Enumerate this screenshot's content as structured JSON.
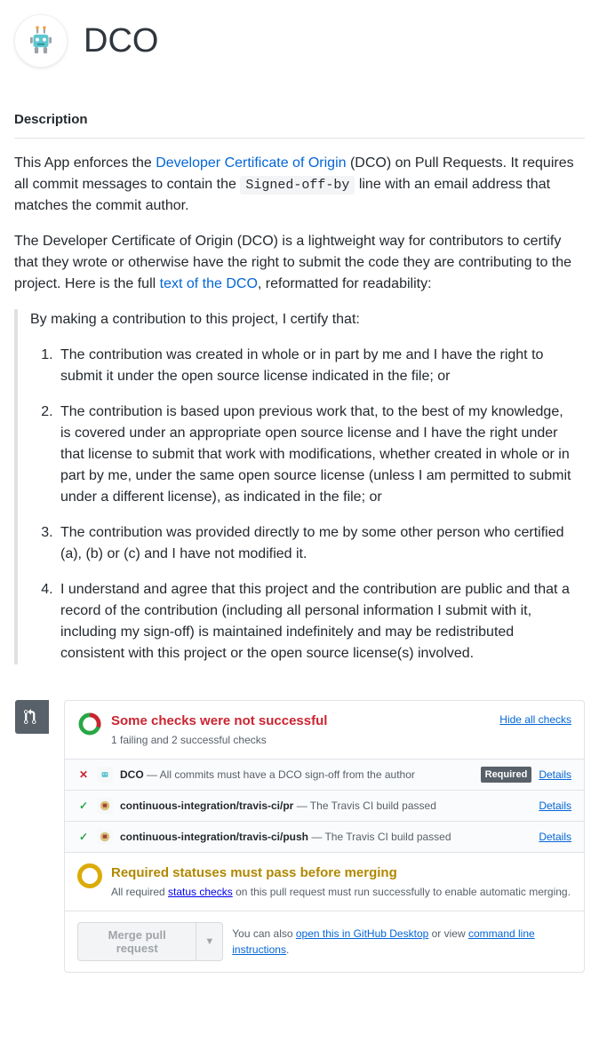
{
  "app": {
    "title": "DCO"
  },
  "section_heading": "Description",
  "para1": {
    "a": "This App enforces the ",
    "link1": "Developer Certificate of Origin",
    "b": " (DCO) on Pull Requests. It requires all commit messages to contain the ",
    "code": "Signed-off-by",
    "c": " line with an email address that matches the commit author."
  },
  "para2": {
    "a": "The Developer Certificate of Origin (DCO) is a lightweight way for contributors to certify that they wrote or otherwise have the right to submit the code they are contributing to the project. Here is the full ",
    "link": "text of the DCO",
    "b": ", reformatted for readability:"
  },
  "quote_intro": "By making a contribution to this project, I certify that:",
  "quote_items": [
    "The contribution was created in whole or in part by me and I have the right to submit it under the open source license indicated in the file; or",
    "The contribution is based upon previous work that, to the best of my knowledge, is covered under an appropriate open source license and I have the right under that license to submit that work with modifications, whether created in whole or in part by me, under the same open source license (unless I am permitted to submit under a different license), as indicated in the file; or",
    "The contribution was provided directly to me by some other person who certified (a), (b) or (c) and I have not modified it.",
    "I understand and agree that this project and the contribution are public and that a record of the contribution (including all personal information I submit with it, including my sign-off) is maintained indefinitely and may be redistributed consistent with this project or the open source license(s) involved."
  ],
  "checks_panel": {
    "title": "Some checks were not successful",
    "subtitle": "1 failing and 2 successful checks",
    "hide_link": "Hide all checks",
    "rows": [
      {
        "status": "fail",
        "avatar": "robot",
        "name": "DCO",
        "desc": " — All commits must have a DCO sign-off from the author",
        "required": true,
        "details": "Details"
      },
      {
        "status": "pass",
        "avatar": "travis",
        "name": "continuous-integration/travis-ci/pr",
        "desc": " — The Travis CI build passed",
        "required": false,
        "details": "Details"
      },
      {
        "status": "pass",
        "avatar": "travis",
        "name": "continuous-integration/travis-ci/push",
        "desc": " — The Travis CI build passed",
        "required": false,
        "details": "Details"
      }
    ],
    "required_badge": "Required",
    "required_title": "Required statuses must pass before merging",
    "required_sub_a": "All required ",
    "required_sub_link": "status checks",
    "required_sub_b": " on this pull request must run successfully to enable automatic merging."
  },
  "merge_footer": {
    "button": "Merge pull request",
    "text_a": "You can also ",
    "link1": "open this in GitHub Desktop",
    "text_b": " or view ",
    "link2": "command line instructions",
    "text_c": "."
  }
}
